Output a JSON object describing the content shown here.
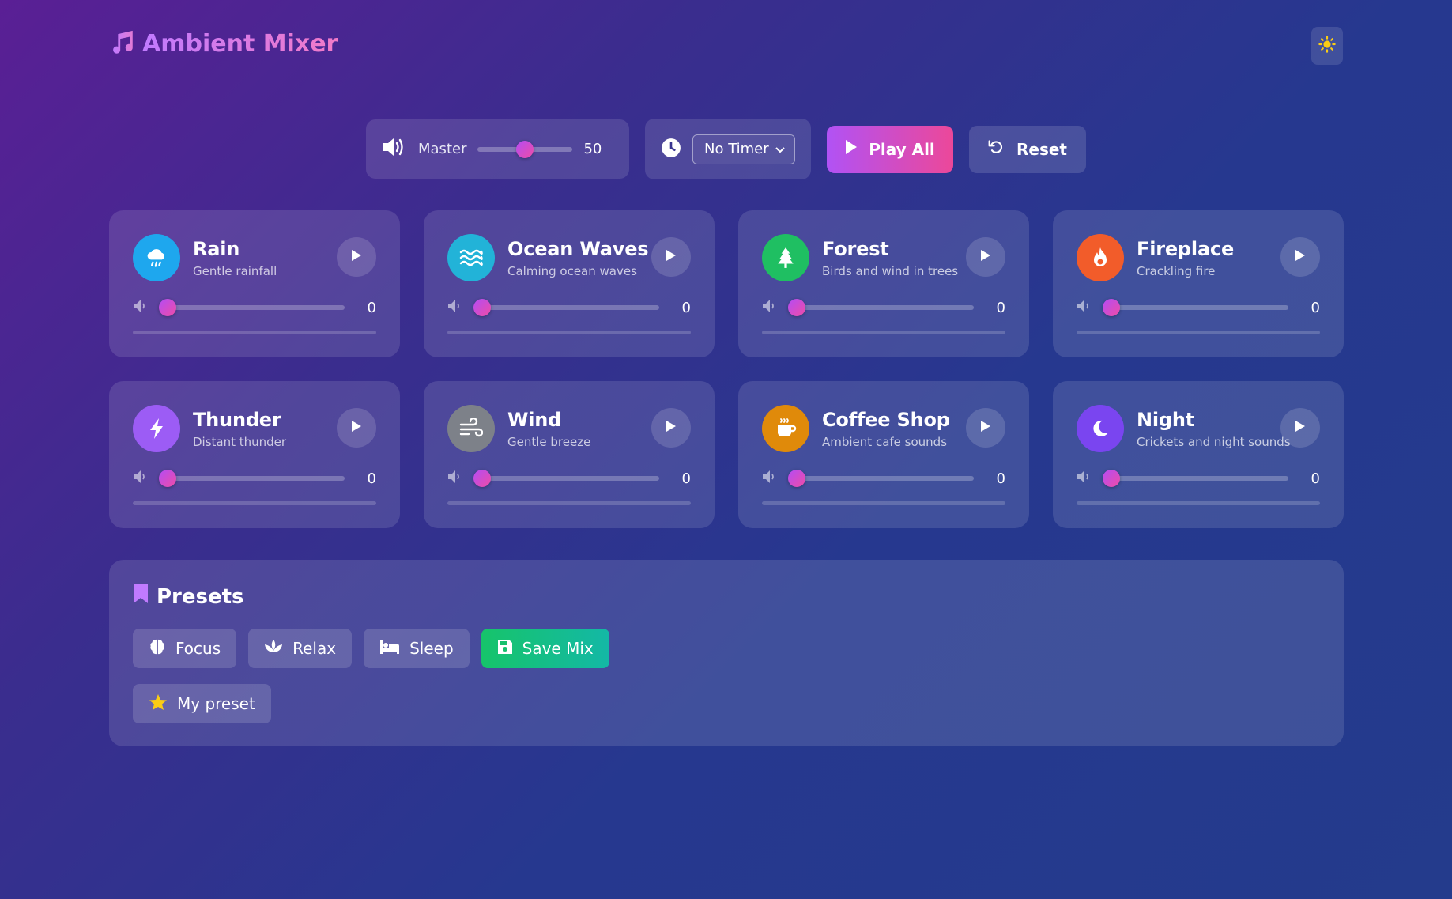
{
  "app": {
    "title": "Ambient Mixer",
    "accent_gradient": [
      "#c07aff",
      "#f27ac8"
    ]
  },
  "header": {
    "logo_icon": "music-note-icon",
    "theme_icon": "sun-icon"
  },
  "controls": {
    "master_label": "Master",
    "master_value": "50",
    "master_level": 0.5,
    "timer_selected": "No Timer",
    "play_all_label": "Play All",
    "reset_label": "Reset"
  },
  "sounds": [
    {
      "name": "Rain",
      "description": "Gentle rainfall",
      "volume": "0",
      "icon": "cloud-rain-icon",
      "color": "#1ea7ee"
    },
    {
      "name": "Ocean Waves",
      "description": "Calming ocean waves",
      "volume": "0",
      "icon": "water-waves-icon",
      "color": "#22b3d8"
    },
    {
      "name": "Forest",
      "description": "Birds and wind in trees",
      "volume": "0",
      "icon": "tree-icon",
      "color": "#1fbf62"
    },
    {
      "name": "Fireplace",
      "description": "Crackling fire",
      "volume": "0",
      "icon": "fire-icon",
      "color": "#f25c2a"
    },
    {
      "name": "Thunder",
      "description": "Distant thunder",
      "volume": "0",
      "icon": "lightning-bolt-icon",
      "color": "#9c5cf5"
    },
    {
      "name": "Wind",
      "description": "Gentle breeze",
      "volume": "0",
      "icon": "wind-icon",
      "color": "#7d8189"
    },
    {
      "name": "Coffee Shop",
      "description": "Ambient cafe sounds",
      "volume": "0",
      "icon": "coffee-cup-icon",
      "color": "#e08a0a"
    },
    {
      "name": "Night",
      "description": "Crickets and night sounds",
      "volume": "0",
      "icon": "moon-icon",
      "color": "#7a45f0"
    }
  ],
  "presets": {
    "title": "Presets",
    "items": [
      {
        "label": "Focus",
        "icon": "brain-icon"
      },
      {
        "label": "Relax",
        "icon": "lotus-icon"
      },
      {
        "label": "Sleep",
        "icon": "bed-icon"
      }
    ],
    "save_label": "Save Mix",
    "save_icon": "floppy-disk-icon",
    "custom": [
      {
        "label": "My preset",
        "icon": "star-icon"
      }
    ]
  }
}
